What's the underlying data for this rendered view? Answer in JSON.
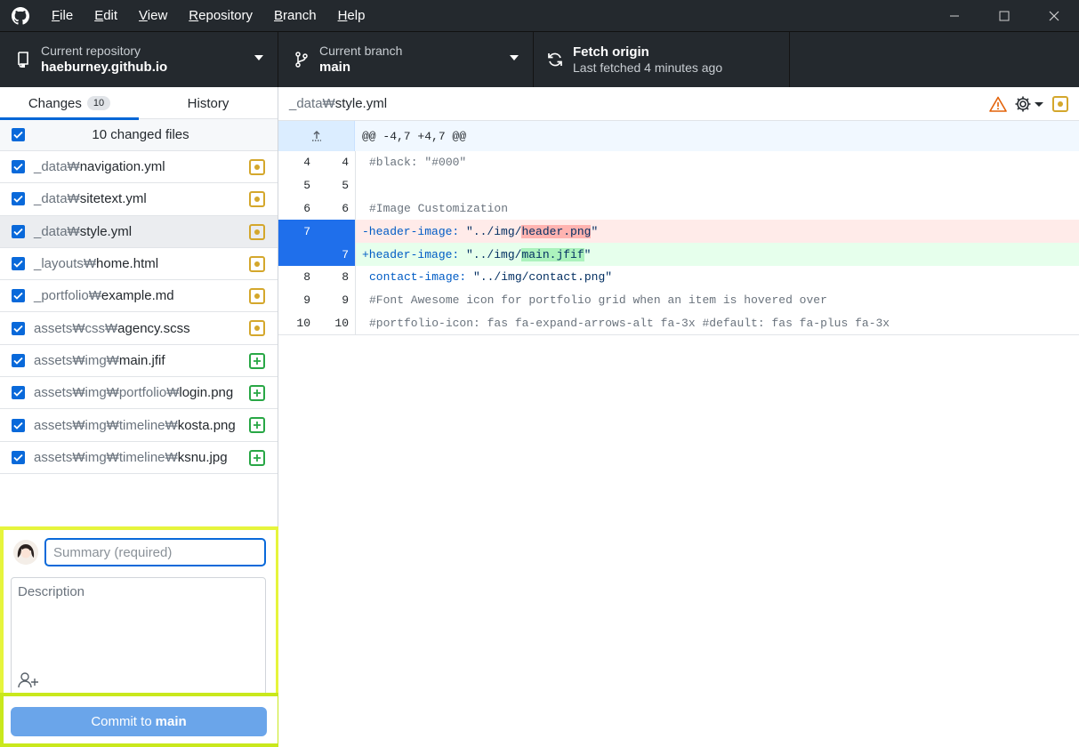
{
  "menu": {
    "items": [
      {
        "mnemonic": "F",
        "rest": "ile"
      },
      {
        "mnemonic": "E",
        "rest": "dit"
      },
      {
        "mnemonic": "V",
        "rest": "iew"
      },
      {
        "mnemonic": "R",
        "rest": "epository"
      },
      {
        "mnemonic": "B",
        "rest": "ranch"
      },
      {
        "mnemonic": "H",
        "rest": "elp"
      }
    ]
  },
  "toolbar": {
    "repo_caption": "Current repository",
    "repo_name": "haeburney.github.io",
    "branch_caption": "Current branch",
    "branch_name": "main",
    "fetch_title": "Fetch origin",
    "fetch_subtitle": "Last fetched 4 minutes ago"
  },
  "sidebar": {
    "tabs": [
      {
        "label": "Changes",
        "count": "10"
      },
      {
        "label": "History"
      }
    ],
    "changed_files_label": "10 changed files",
    "files": [
      {
        "dir": "_data₩",
        "name": "navigation.yml",
        "status": "modified"
      },
      {
        "dir": "_data₩",
        "name": "sitetext.yml",
        "status": "modified"
      },
      {
        "dir": "_data₩",
        "name": "style.yml",
        "status": "modified"
      },
      {
        "dir": "_layouts₩",
        "name": "home.html",
        "status": "modified"
      },
      {
        "dir": "_portfolio₩",
        "name": "example.md",
        "status": "modified"
      },
      {
        "dir": "assets₩css₩",
        "name": "agency.scss",
        "status": "modified"
      },
      {
        "dir": "assets₩img₩",
        "name": "main.jfif",
        "status": "added"
      },
      {
        "dir": "assets₩img₩portfolio₩",
        "name": "login.png",
        "status": "added"
      },
      {
        "dir": "assets₩img₩timeline₩",
        "name": "kosta.png",
        "status": "added"
      },
      {
        "dir": "assets₩img₩timeline₩",
        "name": "ksnu.jpg",
        "status": "added"
      }
    ]
  },
  "commit": {
    "summary_placeholder": "Summary (required)",
    "description_placeholder": "Description",
    "button_prefix": "Commit to",
    "button_branch": "main"
  },
  "diff": {
    "path_dir": "_data₩",
    "path_file": "style.yml",
    "hunk_header": "@@ -4,7 +4,7 @@",
    "lines": {
      "l4": {
        "old": "4",
        "new": "4",
        "text": "#black: \"#000\""
      },
      "l5": {
        "old": "5",
        "new": "5",
        "text": ""
      },
      "l6": {
        "old": "6",
        "new": "6",
        "text": "#Image Customization"
      },
      "del": {
        "old": "7",
        "key": "-header-image:",
        "pre": " \"../img/",
        "hl": "header.png",
        "post": "\""
      },
      "add": {
        "new": "7",
        "key": "+header-image:",
        "pre": " \"../img/",
        "hl": "main.jfif",
        "post": "\""
      },
      "l8": {
        "old": "8",
        "new": "8",
        "key": "contact-image:",
        "rest": " \"../img/contact.png\""
      },
      "l9": {
        "old": "9",
        "new": "9",
        "text": "#Font Awesome icon for portfolio grid when an item is hovered over"
      },
      "l10": {
        "old": "10",
        "new": "10",
        "text": "#portfolio-icon: fas fa-expand-arrows-alt fa-3x #default: fas fa-plus fa-3x"
      }
    }
  }
}
